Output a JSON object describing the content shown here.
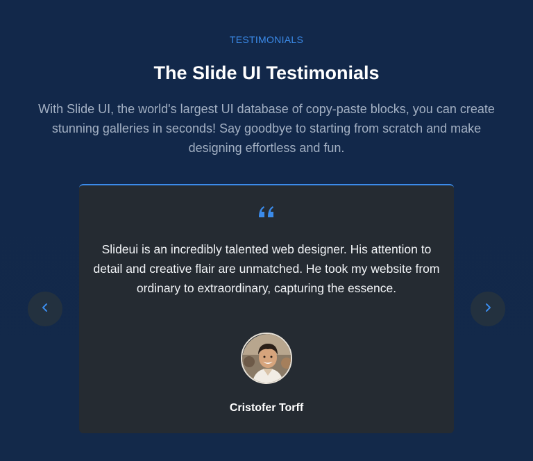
{
  "section": {
    "eyebrow": "TESTIMONIALS",
    "title": "The Slide UI Testimonials",
    "subtitle": "With Slide UI, the world's largest UI database of copy-paste blocks, you can create stunning galleries in seconds! Say goodbye to starting from scratch and make designing effortless and fun."
  },
  "testimonial": {
    "quote": "Slideui is an incredibly talented web designer. His attention to detail and creative flair are unmatched. He took my website from ordinary to extraordinary, capturing the essence.",
    "author": "Cristofer Torff",
    "quote_icon": "quote-icon",
    "avatar_icon": "avatar"
  },
  "nav": {
    "prev_icon": "chevron-left-icon",
    "next_icon": "chevron-right-icon"
  },
  "colors": {
    "background": "#13294a",
    "accent": "#3b8bea",
    "card": "#252b32",
    "nav_button": "#23313f"
  }
}
